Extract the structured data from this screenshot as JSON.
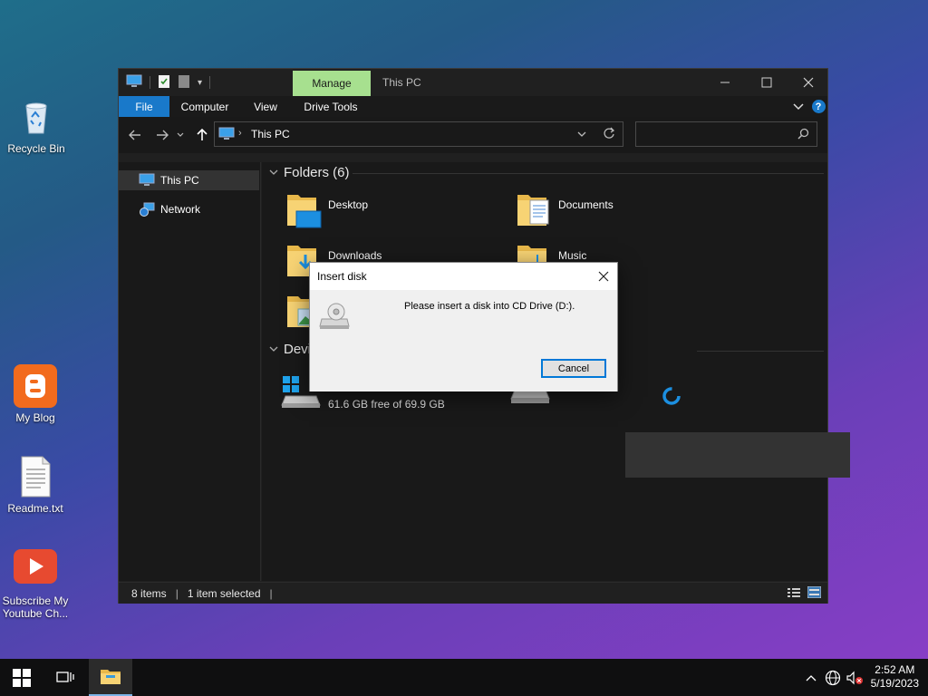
{
  "desktop": {
    "icons": [
      {
        "label": "Recycle Bin"
      },
      {
        "label": "My Blog"
      },
      {
        "label": "Readme.txt"
      },
      {
        "label": "Subscribe My Youtube Ch..."
      }
    ]
  },
  "explorer": {
    "title": "This PC",
    "contextual_tab": "Manage",
    "ribbon_tabs": [
      "File",
      "Computer",
      "View",
      "Drive Tools"
    ],
    "address": {
      "location": "This PC"
    },
    "search": {
      "placeholder": ""
    },
    "nav_pane": [
      "This PC",
      "Network"
    ],
    "groups": {
      "folders": "Folders (6)",
      "devices": "Devi"
    },
    "folders": [
      "Desktop",
      "Documents",
      "Downloads",
      "Music"
    ],
    "drive_c": {
      "free_text": "61.6 GB free of 69.9 GB"
    },
    "status": {
      "items": "8 items",
      "selected": "1 item selected"
    }
  },
  "dialog": {
    "title": "Insert disk",
    "message": "Please insert a disk into CD Drive (D:).",
    "cancel_label": "Cancel"
  },
  "taskbar": {
    "time": "2:52 AM",
    "date": "5/19/2023"
  },
  "colors": {
    "accent": "#1979ca",
    "manage_tab": "#a7e08f",
    "focus_border": "#0078d7"
  }
}
